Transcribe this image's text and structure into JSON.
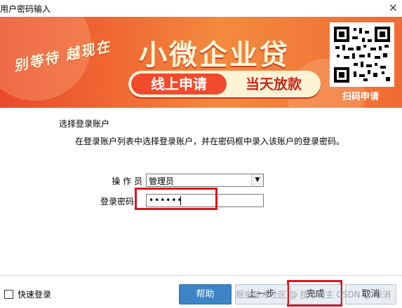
{
  "window": {
    "title": "用户密码输入",
    "close_glyph": "×"
  },
  "banner": {
    "slogan": "别等待 越现在",
    "title": "小微企业贷",
    "apply_label": "线上申请",
    "same_day_label": "当天放款",
    "qr_caption": "扫码申请",
    "colors": {
      "primary": "#ef5a2f",
      "accent": "#fff3d6",
      "cta": "#f24a2c"
    }
  },
  "form": {
    "section_title": "选择登录账户",
    "section_desc": "在登录账户列表中选择登录账户，并在密码框中录入该账户的登录密码。",
    "operator_label": "操 作 员",
    "operator_value": "管理员",
    "password_label": "登录密码",
    "password_value": "••••••"
  },
  "footer": {
    "quick_login_label": "快速登录",
    "help_label": "帮助",
    "back_label": "上一步",
    "finish_label": "完成",
    "cancel_label": "取消",
    "watermark": "掘金技术社区 @ 技术博主 CSDN @ 取消"
  }
}
